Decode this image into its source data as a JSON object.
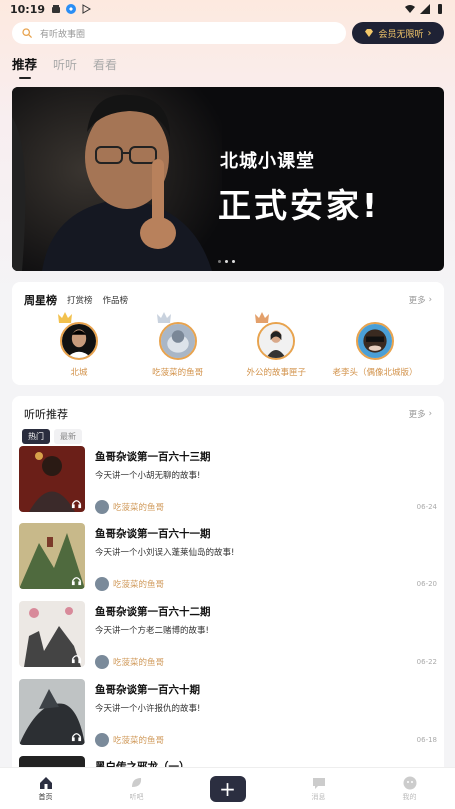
{
  "status_bar": {
    "time": "10:19"
  },
  "search": {
    "placeholder": "有听故事圈"
  },
  "vip": {
    "label": "会员无限听"
  },
  "top_tabs": [
    {
      "label": "推荐"
    },
    {
      "label": "听听"
    },
    {
      "label": "看看"
    }
  ],
  "banner": {
    "line1": "北城小课堂",
    "line2": "正式安家!"
  },
  "weekly": {
    "title": "周星榜",
    "tabs": [
      "打赏榜",
      "作品榜"
    ],
    "more": "更多",
    "users": [
      {
        "name": "北城"
      },
      {
        "name": "吃菠菜的鱼哥"
      },
      {
        "name": "外公的故事匣子"
      },
      {
        "name": "老李头（偶像北城版）"
      }
    ]
  },
  "listen": {
    "title": "听听推荐",
    "more": "更多",
    "pills": [
      "热门",
      "最新"
    ],
    "stories": [
      {
        "title": "鱼哥杂谈第一百六十三期",
        "desc": "今天讲一个小胡无聊的故事!",
        "author": "吃菠菜的鱼哥",
        "date": "06-24"
      },
      {
        "title": "鱼哥杂谈第一百六十一期",
        "desc": "今天讲一个小刘误入蓬莱仙岛的故事!",
        "author": "吃菠菜的鱼哥",
        "date": "06-20"
      },
      {
        "title": "鱼哥杂谈第一百六十二期",
        "desc": "今天讲一个方老二赌博的故事!",
        "author": "吃菠菜的鱼哥",
        "date": "06-22"
      },
      {
        "title": "鱼哥杂谈第一百六十期",
        "desc": "今天讲一个小许报仇的故事!",
        "author": "吃菠菜的鱼哥",
        "date": "06-18"
      },
      {
        "title": "黑白传之邪龙（一）",
        "desc": "",
        "author": "",
        "date": ""
      }
    ]
  },
  "bottom_nav": [
    {
      "label": "首页"
    },
    {
      "label": "听吧"
    },
    {
      "label": ""
    },
    {
      "label": "消息"
    },
    {
      "label": "我的"
    }
  ]
}
